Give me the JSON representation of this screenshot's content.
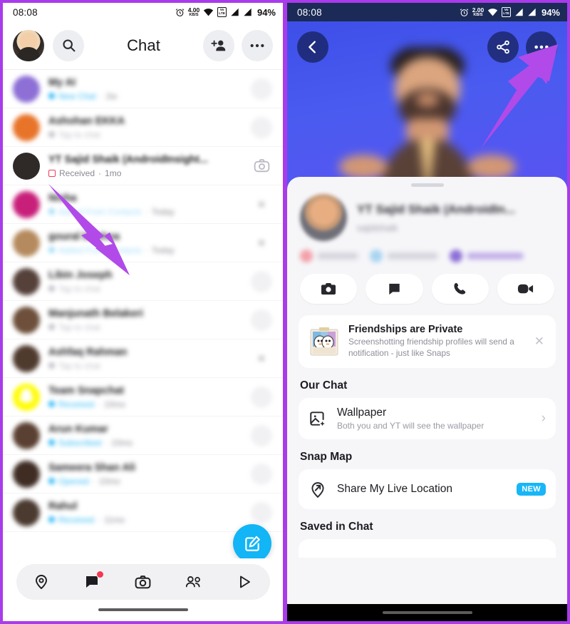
{
  "left_phone": {
    "status_bar": {
      "time": "08:08",
      "alarm_icon": "alarm-icon",
      "net_speed_value": "4.00",
      "net_speed_unit": "KB/S",
      "wifi_icon": "wifi-icon",
      "volte_line1": "Vo",
      "volte_line2": "LTE",
      "signal_icon": "signal-bars-icon",
      "battery": "94%"
    },
    "header": {
      "avatar": "bitmoji-avatar",
      "search_icon": "search-icon",
      "title": "Chat",
      "add_friend_icon": "add-friend-icon",
      "more_icon": "more-options-icon"
    },
    "chat_rows": [
      {
        "name": "My AI",
        "status": "New Chat",
        "time": "2w",
        "avatar_color": "#8d6fd6",
        "status_color": "#2fb9f6",
        "right": "ghost",
        "blur": "blurred"
      },
      {
        "name": "Ashohan EKKA",
        "status": "Tap to chat",
        "time": "",
        "avatar_color": "#e8742a",
        "status_color": "#bdbdc6",
        "right": "ghost",
        "blur": "blurred"
      },
      {
        "name": "YT Sajid Shaik (AndroidInsight...",
        "status": "Received",
        "time": "1mo",
        "avatar_color": "#2f2a28",
        "status_color": "#f23c52",
        "right": "camera",
        "blur": "name-only"
      },
      {
        "name": "Nisha",
        "status": "Added From Contacts",
        "time": "Today",
        "avatar_color": "#c81f7a",
        "status_color": "#9fdcf8",
        "right": "close",
        "blur": "blurred"
      },
      {
        "name": "goural krishna",
        "status": "Added From Contacts",
        "time": "Today",
        "avatar_color": "#b58a5e",
        "status_color": "#9fdcf8",
        "right": "close",
        "blur": "blurred"
      },
      {
        "name": "Libin Joseph",
        "status": "Tap to chat",
        "time": "",
        "avatar_color": "#55403a",
        "status_color": "#bdbdc6",
        "right": "ghost",
        "blur": "blurred"
      },
      {
        "name": "Manjunath Belakeri",
        "status": "Tap to chat",
        "time": "",
        "avatar_color": "#6d4f3b",
        "status_color": "#bdbdc6",
        "right": "ghost",
        "blur": "blurred"
      },
      {
        "name": "Ashfaq Rahman",
        "status": "Tap to chat",
        "time": "",
        "avatar_color": "#4f3a2e",
        "status_color": "#bdbdc6",
        "right": "close",
        "blur": "blurred"
      },
      {
        "name": "Team Snapchat",
        "status": "Received",
        "time": "10mo",
        "avatar_color": "#fffc00",
        "status_color": "#2fb9f6",
        "right": "ghost",
        "blur": "blurred"
      },
      {
        "name": "Arun Kumar",
        "status": "Subscribed",
        "time": "10mo",
        "avatar_color": "#5a4032",
        "status_color": "#2fb9f6",
        "right": "ghost",
        "blur": "blurred"
      },
      {
        "name": "Sameera Shan Ali",
        "status": "Opened",
        "time": "10mo",
        "avatar_color": "#3f2d24",
        "status_color": "#2fb9f6",
        "right": "ghost",
        "blur": "blurred"
      },
      {
        "name": "Rahul",
        "status": "Received",
        "time": "11mo",
        "avatar_color": "#4a3a30",
        "status_color": "#2fb9f6",
        "right": "ghost",
        "blur": "blurred"
      }
    ],
    "fab": {
      "icon": "new-chat-icon",
      "color": "#12b5f5"
    },
    "bottom_nav": [
      {
        "icon": "map-pin-icon",
        "label": "Map",
        "active": false,
        "badge": false
      },
      {
        "icon": "chat-bubble-icon",
        "label": "Chat",
        "active": true,
        "badge": true
      },
      {
        "icon": "camera-icon",
        "label": "Camera",
        "active": false,
        "badge": false
      },
      {
        "icon": "friends-icon",
        "label": "Friends",
        "active": false,
        "badge": false
      },
      {
        "icon": "spotlight-play-icon",
        "label": "Spotlight",
        "active": false,
        "badge": false
      }
    ]
  },
  "right_phone": {
    "status_bar": {
      "time": "08:08",
      "alarm_icon": "alarm-icon",
      "net_speed_value": "2.00",
      "net_speed_unit": "KB/S",
      "wifi_icon": "wifi-icon",
      "volte_line1": "Vo",
      "volte_line2": "LTE",
      "signal_icon": "signal-bars-icon",
      "battery": "94%"
    },
    "hero": {
      "back_icon": "back-arrow-icon",
      "share_icon": "share-icon",
      "more_icon": "more-options-icon",
      "background_color": "#4a5bf0"
    },
    "profile": {
      "name": "YT Sajid Shaik (AndroidIn...",
      "username": "sajidshaik",
      "chips": [
        {
          "label": "Streak",
          "color": "#f2a0a8"
        },
        {
          "label": "Snapscore",
          "color": "#a8d4f0"
        },
        {
          "label": "Charms",
          "color": "#8d6fd6"
        }
      ]
    },
    "actions": [
      {
        "icon": "camera-icon",
        "label": "Camera"
      },
      {
        "icon": "chat-bubble-icon",
        "label": "Chat"
      },
      {
        "icon": "phone-icon",
        "label": "Call"
      },
      {
        "icon": "video-camera-icon",
        "label": "Video Call"
      }
    ],
    "notice": {
      "image": "friendship-polaroid-icon",
      "title": "Friendships are Private",
      "subtitle": "Screenshotting friendship profiles will send a notification - just like Snaps",
      "close_icon": "close-icon"
    },
    "sections": [
      {
        "title": "Our Chat",
        "rows": [
          {
            "icon": "wallpaper-icon",
            "label": "Wallpaper",
            "sub": "Both you and YT will see the wallpaper",
            "accessory": "chevron",
            "chevron": "›",
            "badge": ""
          }
        ]
      },
      {
        "title": "Snap Map",
        "rows": [
          {
            "icon": "location-share-icon",
            "label": "Share My Live Location",
            "sub": "",
            "accessory": "badge",
            "chevron": "",
            "badge": "NEW"
          }
        ]
      }
    ],
    "saved_section_title": "Saved in Chat"
  },
  "annotations": [
    {
      "name": "arrow-to-chat-avatar",
      "color": "#b14ae8",
      "points_at": "chat-row-avatar"
    },
    {
      "name": "arrow-to-more-options",
      "color": "#b14ae8",
      "points_at": "more-options-button"
    }
  ]
}
